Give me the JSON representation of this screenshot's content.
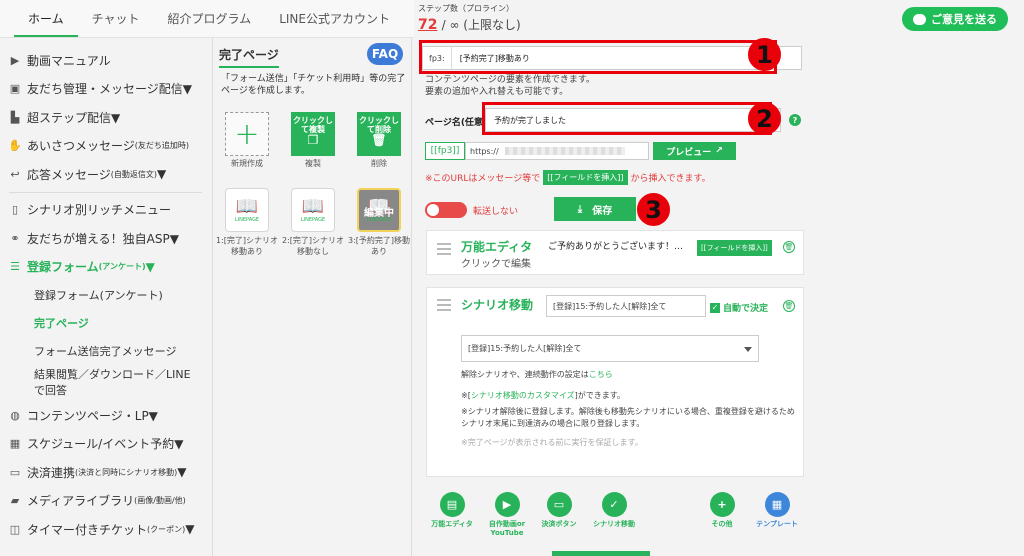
{
  "topnav": {
    "tabs": [
      "ホーム",
      "チャット",
      "紹介プログラム",
      "LINE公式アカウント"
    ]
  },
  "steps": {
    "label": "ステップ数（プロライン）",
    "count": "72",
    "rest": "/ ∞ (上限なし)"
  },
  "feedback": {
    "label": "ご意見を送る"
  },
  "sidebar": {
    "items": [
      {
        "label": "動画マニュアル",
        "icon": "video-icon"
      },
      {
        "label": "友だち管理・メッセージ配信▼",
        "icon": "contacts-icon"
      },
      {
        "label": "超ステップ配信▼",
        "icon": "steps-icon"
      },
      {
        "label": "あいさつメッセージ",
        "small": "(友だち追加時)",
        "icon": "wave-icon"
      },
      {
        "label": "応答メッセージ",
        "small": "(自動返信文)",
        "suffix": "▼",
        "icon": "reply-icon"
      },
      {
        "label": "シナリオ別リッチメニュー",
        "icon": "phone-icon"
      },
      {
        "label": "友だちが増える！独自ASP▼",
        "icon": "handshake-icon"
      },
      {
        "label": "登録フォーム",
        "small": "(アンケート)",
        "suffix": "▼",
        "icon": "list-icon"
      }
    ],
    "subitems": [
      "登録フォーム(アンケート)",
      "完了ページ",
      "フォーム送信完了メッセージ",
      "結果閲覧／ダウンロード／LINEで回答"
    ],
    "items2": [
      {
        "label": "コンテンツページ・LP▼",
        "icon": "globe-icon"
      },
      {
        "label": "スケジュール/イベント予約▼",
        "icon": "calendar-icon"
      },
      {
        "label": "決済連携",
        "small": "(決済と同時にシナリオ移動)",
        "suffix": "▼",
        "icon": "card-icon"
      },
      {
        "label": "メディアライブラリ",
        "small": "(画像/動画/他)",
        "icon": "folder-icon"
      },
      {
        "label": "タイマー付きチケット",
        "small": "(クーポン)",
        "suffix": "▼",
        "icon": "ticket-icon"
      }
    ]
  },
  "midpanel": {
    "title": "完了ページ",
    "faq": "FAQ",
    "desc": "「フォーム送信」「チケット利用時」等の完了ページを作成します。",
    "new_caption": "新規作成",
    "copy_label": "クリックして複製",
    "copy_caption": "複製",
    "delete_label": "クリックして削除",
    "delete_caption": "削除",
    "editing_label": "編集中",
    "book_mini": "LINEPAGE",
    "pages": [
      "1:[完了]シナリオ移動あり",
      "2:[完了]シナリオ移動なし",
      "3:[予約完了]移動あり"
    ]
  },
  "main": {
    "fp_prefix": "fp3:",
    "fp_value": "[予約完了]移動あり",
    "desc_lines": [
      "コンテンツページの要素を作成できます。",
      "要素の追加や入れ替えも可能です。"
    ],
    "page_name_label": "ページ名(任意)",
    "page_name_value": "予約が完了しました",
    "help": "?",
    "url_tag": "[[fp3]]",
    "url_value": "https://",
    "preview": "プレビュー",
    "warn_pre": "※このURLはメッセージ等で",
    "warn_tag": "[[フィールドを挿入]]",
    "warn_post": "から挿入できます。",
    "toggle_label": "転送しない",
    "save": "保存",
    "badges": [
      "1",
      "2",
      "3"
    ],
    "card1": {
      "title": "万能エディタ",
      "sub": "クリックで編集",
      "preview_text": "ご予約ありがとうございます！…",
      "insert": "[[フィールドを挿入]]"
    },
    "card2": {
      "title": "シナリオ移動",
      "select1": "[登録]15:予約した人[解除]全て",
      "auto": "自動で決定",
      "select2": "[登録]15:予約した人[解除]全て",
      "note1_pre": "解除シナリオや、連続動作の設定は",
      "note1_link": "こちら",
      "note2_pre": "※[",
      "note2_link": "シナリオ移動のカスタマイズ",
      "note2_post": "]ができます。",
      "note3": "※シナリオ解除後に登録します。解除後も移動先シナリオにいる場合、重複登録を避けるためシナリオ末尾に到達済みの場合に限り登録します。",
      "note4": "※完了ページが表示される前に実行を保証します。"
    },
    "palette": [
      {
        "label": "万能エディタ",
        "icon": "editor-icon",
        "glyph": "▤"
      },
      {
        "label": "自作動画or YouTube",
        "icon": "youtube-icon",
        "glyph": "▶"
      },
      {
        "label": "決済ボタン",
        "icon": "card-icon",
        "glyph": "▭"
      },
      {
        "label": "シナリオ移動",
        "icon": "check-icon",
        "glyph": "✓"
      },
      {
        "label": "その他",
        "icon": "plus-icon",
        "glyph": "+"
      },
      {
        "label": "テンプレート",
        "icon": "template-icon",
        "glyph": "▦"
      }
    ]
  }
}
